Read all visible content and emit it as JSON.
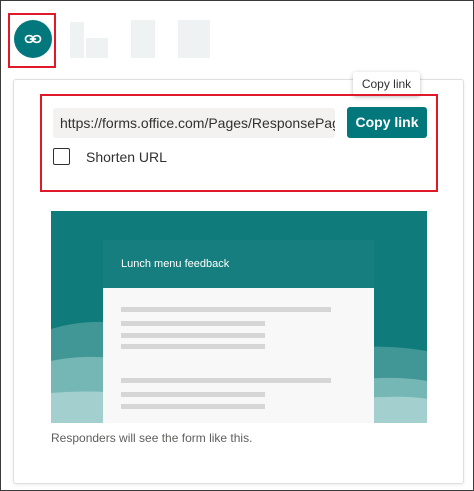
{
  "tooltip": {
    "text": "Copy link"
  },
  "share": {
    "url": "https://forms.office.com/Pages/ResponsePag...",
    "copy_label": "Copy link",
    "shorten_label": "Shorten URL",
    "shorten_checked": false
  },
  "preview": {
    "form_title": "Lunch menu feedback",
    "caption": "Responders will see the form like this."
  },
  "icons": {
    "top_button": "link-icon"
  },
  "colors": {
    "accent": "#03787c",
    "highlight": "#e0192a"
  }
}
